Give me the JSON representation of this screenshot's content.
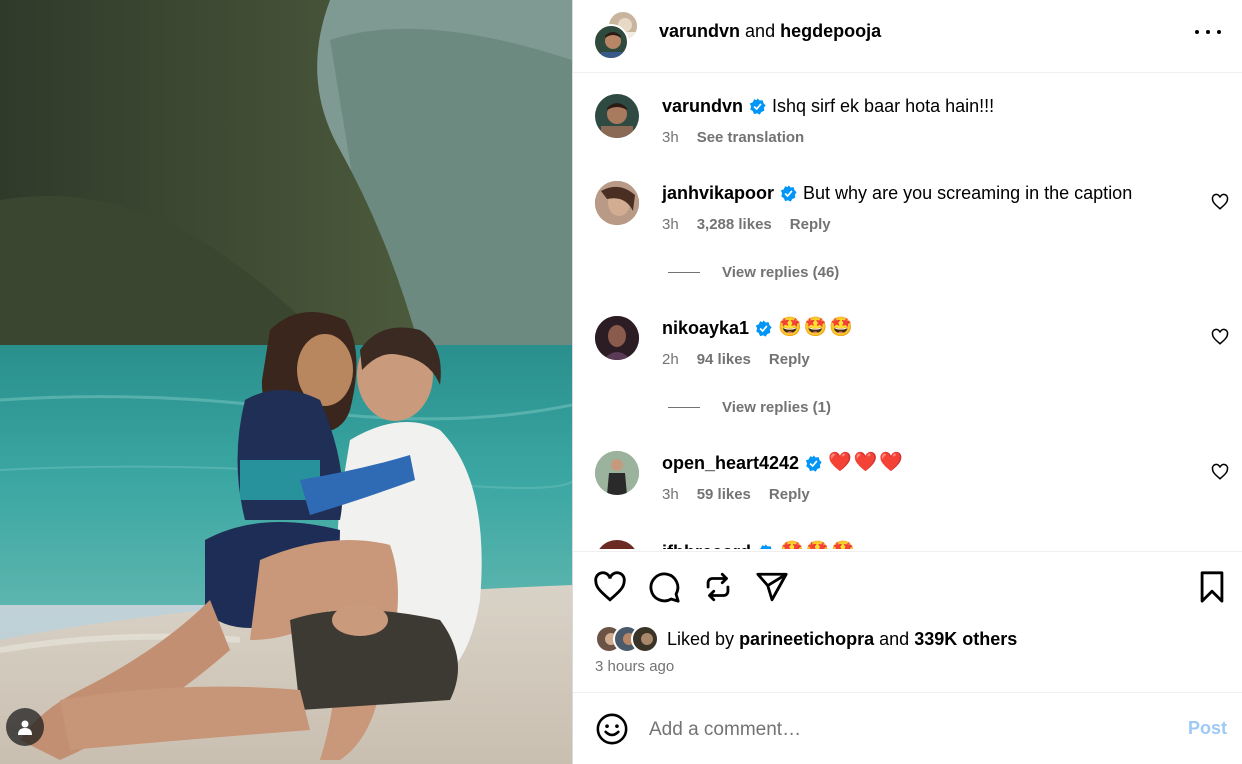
{
  "header": {
    "user1": "varundvn",
    "and_text": "and",
    "user2": "hegdepooja"
  },
  "caption": {
    "user": "varundvn",
    "text": "Ishq sirf ek baar hota hain!!!",
    "time": "3h",
    "see_translation": "See translation"
  },
  "comments": [
    {
      "user": "janhvikapoor",
      "text": "But why are you screaming in the caption",
      "time": "3h",
      "likes": "3,288 likes",
      "reply": "Reply",
      "view_replies": "View replies (46)"
    },
    {
      "user": "nikoayka1",
      "text": "🤩🤩🤩",
      "time": "2h",
      "likes": "94 likes",
      "reply": "Reply",
      "view_replies": "View replies (1)"
    },
    {
      "user": "open_heart4242",
      "text": "❤️❤️❤️",
      "time": "3h",
      "likes": "59 likes",
      "reply": "Reply"
    },
    {
      "user": "ifbbrecord",
      "text": "🤩🤩🤩"
    }
  ],
  "likes": {
    "prefix": "Liked by",
    "user": "parineetichopra",
    "and_text": "and",
    "others": "339K others"
  },
  "time_ago": "3 hours ago",
  "comment_box": {
    "placeholder": "Add a comment…",
    "post_label": "Post"
  },
  "icons": {
    "like": "heart-icon",
    "comment": "comment-icon",
    "repost": "repost-icon",
    "share": "share-icon",
    "save": "bookmark-icon",
    "emoji": "smiley-icon",
    "more": "more-options-icon",
    "verified": "verified-badge-icon",
    "tag": "user-tag-icon"
  },
  "colors": {
    "verified": "#0095f6",
    "meta_text": "#737373",
    "post_disabled": "#9ec9f5"
  }
}
